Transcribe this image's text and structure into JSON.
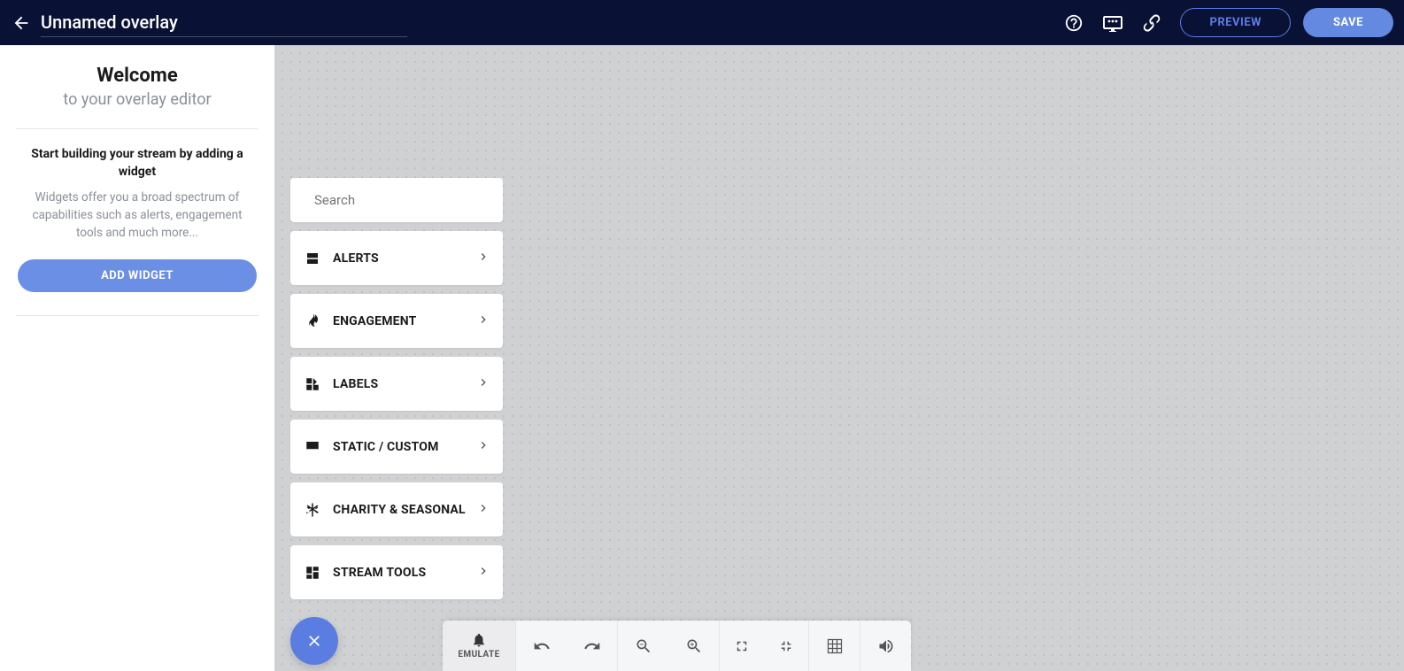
{
  "header": {
    "title": "Unnamed overlay",
    "preview_label": "PREVIEW",
    "save_label": "SAVE"
  },
  "sidebar": {
    "welcome_title": "Welcome",
    "welcome_subtitle": "to your overlay editor",
    "lead": "Start building your stream by adding a widget",
    "description": "Widgets offer you a broad spectrum of capabilities such as alerts, engagement tools and much more...",
    "add_widget_label": "ADD WIDGET"
  },
  "picker": {
    "search_placeholder": "Search",
    "categories": [
      {
        "label": "ALERTS",
        "icon": "server"
      },
      {
        "label": "ENGAGEMENT",
        "icon": "fire"
      },
      {
        "label": "LABELS",
        "icon": "widgets"
      },
      {
        "label": "STATIC / CUSTOM",
        "icon": "panel"
      },
      {
        "label": "CHARITY & SEASONAL",
        "icon": "snow"
      },
      {
        "label": "STREAM TOOLS",
        "icon": "dashboard"
      }
    ]
  },
  "toolbar": {
    "emulate_label": "EMULATE"
  }
}
